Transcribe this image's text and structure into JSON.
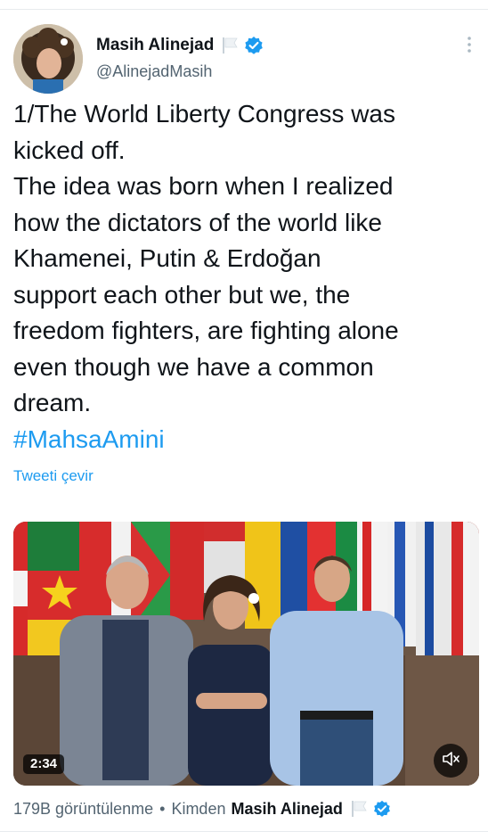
{
  "author": {
    "display_name": "Masih Alinejad",
    "handle": "@AlinejadMasih",
    "avatar_icon": "profile-photo",
    "flag_icon": "white-flag-icon",
    "verified_icon": "verified-badge-icon"
  },
  "tweet": {
    "lines": [
      "1/The World Liberty Congress was",
      "kicked off.",
      "The idea was born when I realized",
      "how the dictators of the world like",
      "Khamenei, Putin & Erdoğan",
      "support each other but we, the",
      "freedom fighters, are fighting alone",
      "even though we have a common",
      "dream."
    ],
    "hashtag": "#MahsaAmini",
    "translate_label": "Tweeti çevir"
  },
  "media": {
    "type": "video",
    "duration": "2:34",
    "mute_icon": "speaker-muted-icon"
  },
  "footer": {
    "views": "179B görüntülenme",
    "separator": "•",
    "from_label": "Kimden",
    "from_name": "Masih Alinejad"
  },
  "colors": {
    "accent": "#1d9bf0",
    "text": "#0f1419",
    "secondary": "#536471"
  }
}
